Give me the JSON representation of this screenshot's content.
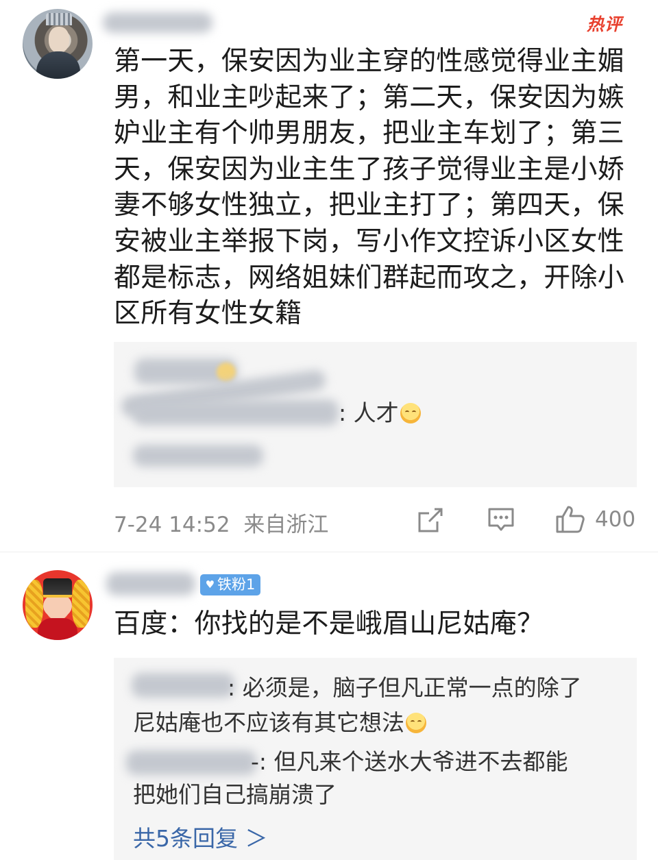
{
  "comments": [
    {
      "avatar_icon": "statue-of-liberty-avatar-icon",
      "badge": "热评",
      "text": "第一天，保安因为业主穿的性感觉得业主媚男，和业主吵起来了；第二天，保安因为嫉妒业主有个帅男朋友，把业主车划了；第三天，保安因为业主生了孩子觉得业主是小娇妻不够女性独立，把业主打了；第四天，保安被业主举报下岗，写小作文控诉小区女性都是标志，网络姐妹们群起而攻之，开除小区所有女性女籍",
      "replies": [
        {
          "text": ": 人才"
        }
      ],
      "timestamp": "7-24 14:52",
      "location": "来自浙江",
      "likes": "400"
    },
    {
      "avatar_icon": "god-of-wealth-avatar-icon",
      "fan_badge": "铁粉1",
      "text": "百度：你找的是不是峨眉山尼姑庵？",
      "replies": [
        {
          "text_line1": ": 必须是，脑子但凡正常一点的除了",
          "text_line2": "尼姑庵也不应该有其它想法"
        },
        {
          "text_line1": "-: 但凡来个送水大爷进不去都能",
          "text_line2": "把她们自己搞崩溃了"
        }
      ],
      "more_replies": "共5条回复 ＞"
    }
  ],
  "colors": {
    "hot_badge": "#e8412f",
    "fan_badge": "#5da3e8",
    "link": "#3a67a8",
    "reply_bg": "#f5f5f5",
    "meta": "#8a8a8a"
  }
}
